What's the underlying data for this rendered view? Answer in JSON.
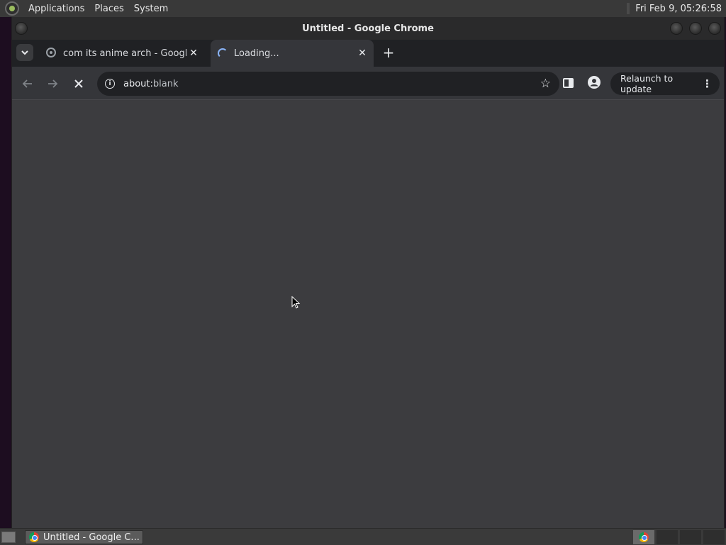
{
  "panel": {
    "menus": [
      "Applications",
      "Places",
      "System"
    ],
    "clock": "Fri Feb  9, 05:26:58"
  },
  "window": {
    "title": "Untitled - Google Chrome"
  },
  "tabs": [
    {
      "title": "com its anime arch - Google",
      "state": "inactive"
    },
    {
      "title": "Loading...",
      "state": "active"
    }
  ],
  "toolbar": {
    "url_host": "about:",
    "url_path": "blank",
    "relaunch_label": "Relaunch to update"
  },
  "taskbar": {
    "task_label": "Untitled - Google C..."
  },
  "icons": {
    "back": "back-arrow-icon",
    "forward": "forward-arrow-icon",
    "stop": "stop-icon",
    "info": "info-icon",
    "bookmark": "star-icon"
  }
}
